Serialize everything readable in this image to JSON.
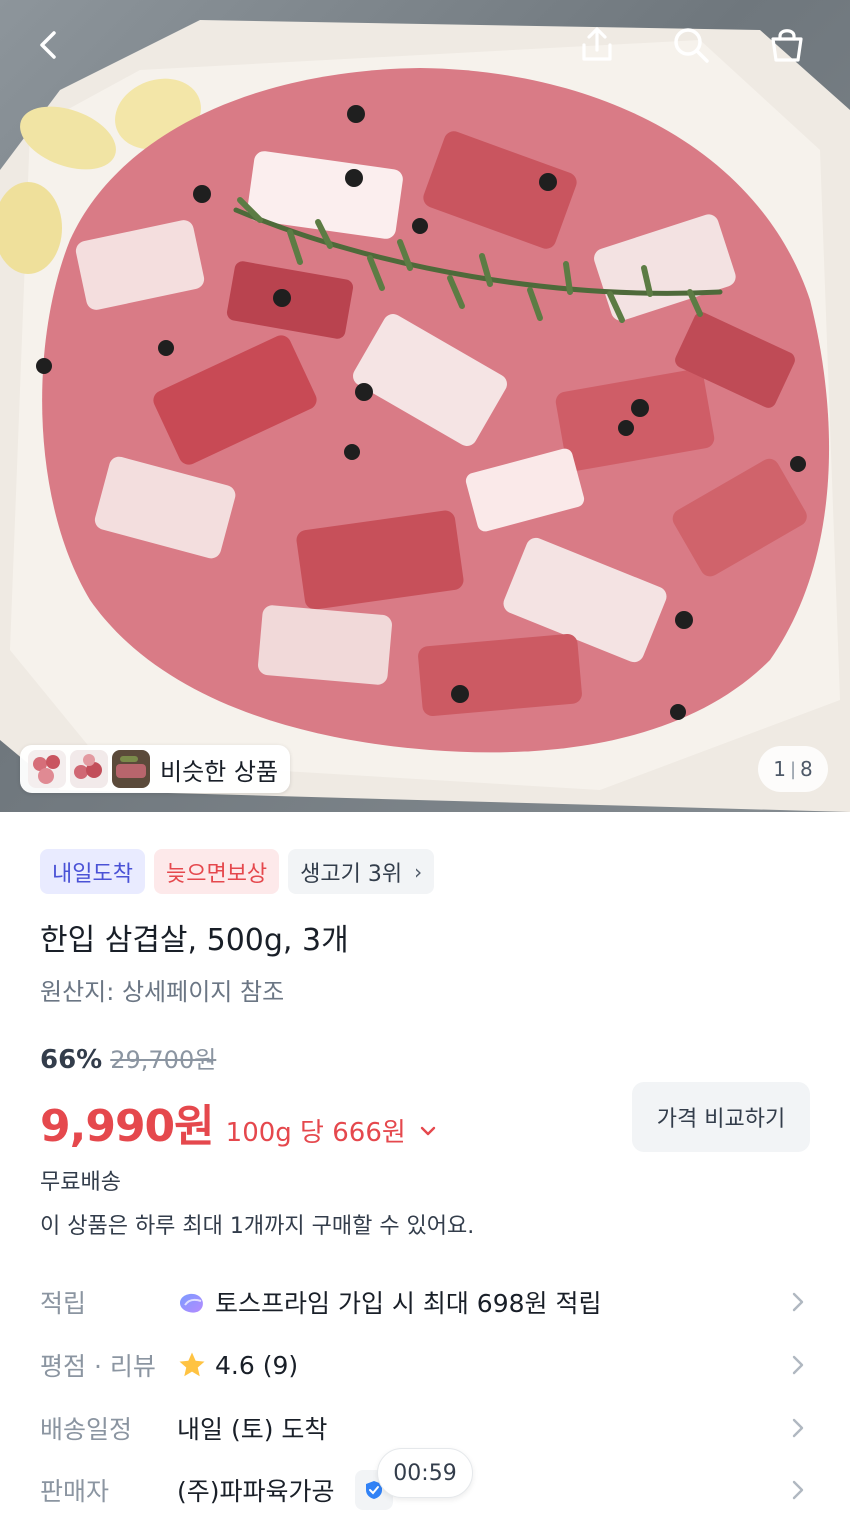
{
  "hero": {
    "similar_label": "비슷한 상품",
    "counter_current": "1",
    "counter_total": "8"
  },
  "icons": {
    "back": "back-arrow-icon",
    "share": "share-icon",
    "search": "search-icon",
    "cart": "shopping-bag-icon"
  },
  "badges": {
    "tomorrow": "내일도착",
    "late_comp": "늦으면보상",
    "rank": "생고기 3위"
  },
  "product": {
    "title": "한입 삼겹살, 500g, 3개",
    "origin": "원산지: 상세페이지 참조",
    "discount": "66%",
    "original_price": "29,700원",
    "price": "9,990원",
    "unit_price": "100g 당 666원",
    "compare_button": "가격 비교하기",
    "shipping": "무료배송",
    "limit_notice": "이 상품은 하루 최대 1개까지 구매할 수 있어요."
  },
  "info": {
    "points_label": "적립",
    "points_value": "토스프라임 가입 시 최대 698원 적립",
    "rating_label": "평점 · 리뷰",
    "rating_value": "4.6 (9)",
    "delivery_label": "배송일정",
    "delivery_value": "내일 (토) 도착",
    "seller_label": "판매자",
    "seller_value": "(주)파파육가공"
  },
  "timer": "00:59",
  "colors": {
    "accent_red": "#e5484d",
    "badge_blue": "#4a52d6",
    "star": "#ffc342"
  }
}
